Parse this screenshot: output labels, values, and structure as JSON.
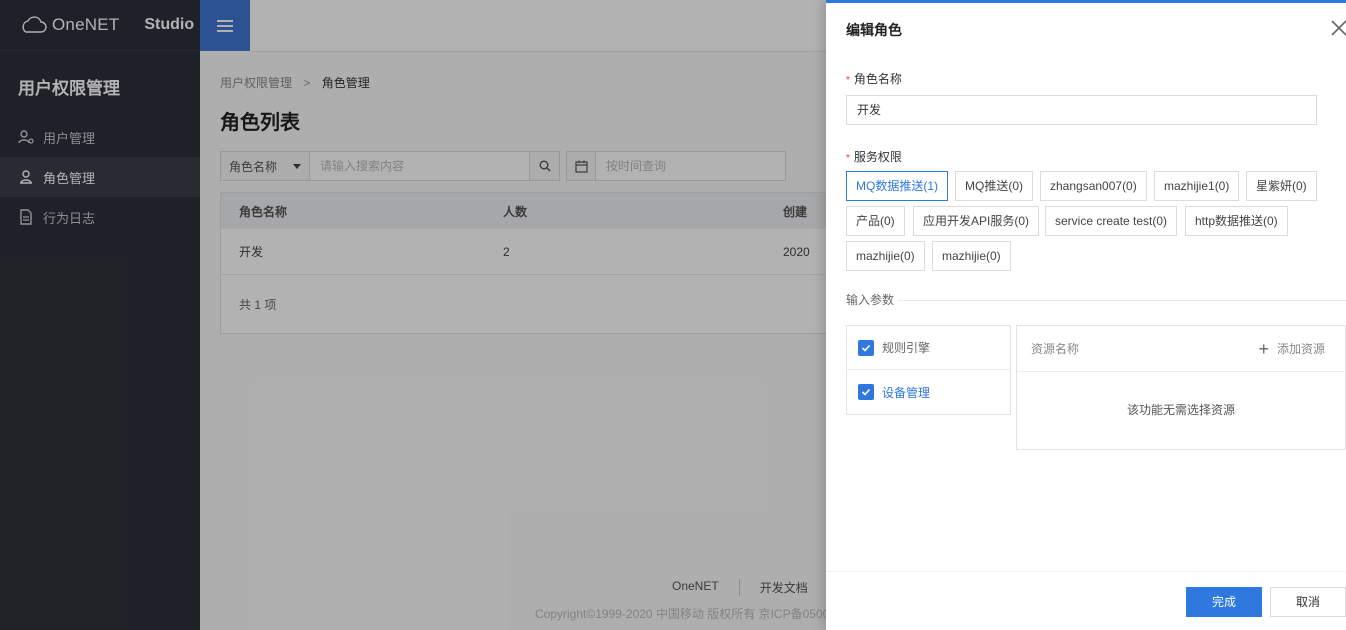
{
  "sidebar": {
    "logo_text": "OneNET",
    "studio_label": "Studio",
    "section_title": "用户权限管理",
    "items": [
      {
        "label": "用户管理",
        "icon": "user-settings-icon",
        "active": false
      },
      {
        "label": "角色管理",
        "icon": "role-icon",
        "active": true
      },
      {
        "label": "行为日志",
        "icon": "document-icon",
        "active": false
      }
    ]
  },
  "main": {
    "breadcrumb": {
      "parent": "用户权限管理",
      "separator": ">",
      "current": "角色管理"
    },
    "page_title": "角色列表",
    "filter": {
      "select_value": "角色名称",
      "search_placeholder": "请输入搜索内容",
      "date_placeholder": "按时间查询"
    },
    "table": {
      "columns": [
        "角色名称",
        "人数",
        "创建"
      ],
      "rows": [
        {
          "name": "开发",
          "count": "2",
          "created": "2020"
        }
      ],
      "total": "共 1 项"
    },
    "footer": {
      "links": [
        "OneNET",
        "开发文档",
        ""
      ],
      "copyright": "Copyright©1999-2020 中国移动 版权所有 京ICP备0500"
    }
  },
  "drawer": {
    "title": "编辑角色",
    "role_name_label": "角色名称",
    "role_name_value": "开发",
    "permissions_label": "服务权限",
    "permissions": [
      {
        "label": "MQ数据推送(1)",
        "selected": true
      },
      {
        "label": "MQ推送(0)",
        "selected": false
      },
      {
        "label": "zhangsan007(0)",
        "selected": false
      },
      {
        "label": "mazhijie1(0)",
        "selected": false
      },
      {
        "label": "星紫妍(0)",
        "selected": false
      },
      {
        "label": "产品(0)",
        "selected": false
      },
      {
        "label": "应用开发API服务(0)",
        "selected": false
      },
      {
        "label": "service create test(0)",
        "selected": false
      },
      {
        "label": "http数据推送(0)",
        "selected": false
      },
      {
        "label": "mazhijie(0)",
        "selected": false
      },
      {
        "label": "mazhijie(0)",
        "selected": false
      }
    ],
    "input_params_label": "输入参数",
    "modules": [
      {
        "label": "规则引擎",
        "checked": true,
        "active": false
      },
      {
        "label": "设备管理",
        "checked": true,
        "active": true
      }
    ],
    "resource": {
      "header": "资源名称",
      "add_label": "添加资源",
      "empty_text": "该功能无需选择资源"
    },
    "confirm_label": "完成",
    "cancel_label": "取消"
  },
  "colors": {
    "sidebar_bg": "#2c3038",
    "accent": "#2f78e0",
    "toggle_bg": "#3f76d3"
  }
}
